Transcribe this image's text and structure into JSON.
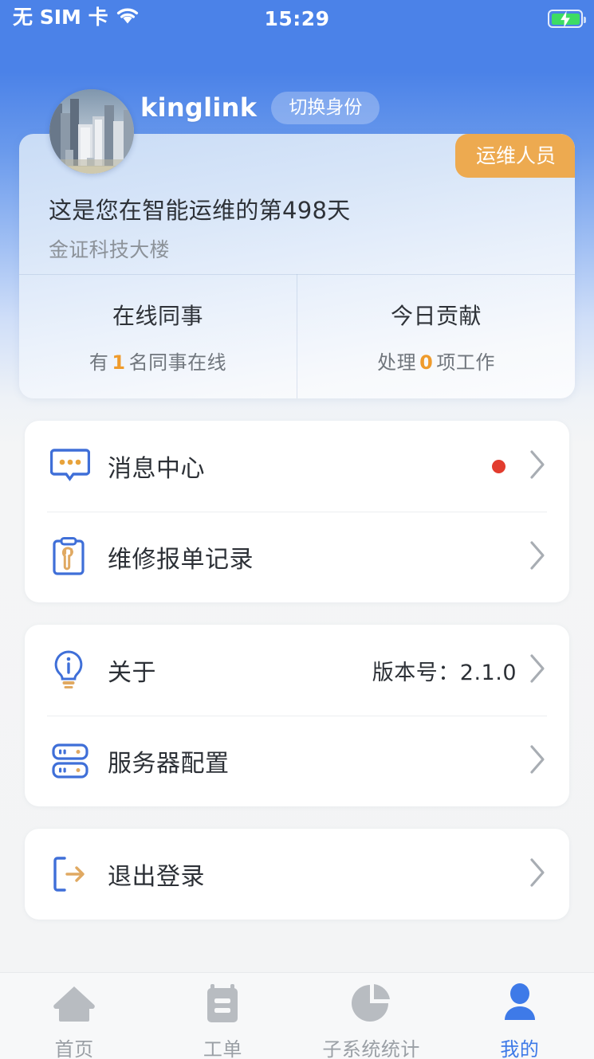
{
  "status_bar": {
    "carrier": "无 SIM 卡",
    "wifi_icon": "wifi-icon",
    "time": "15:29",
    "battery_icon": "battery-charging-icon"
  },
  "header": {
    "avatar_icon": "avatar-city-buildings",
    "username": "kinglink",
    "switch_identity_label": "切换身份"
  },
  "profile_card": {
    "role_badge": "运维人员",
    "days_text": "这是您在智能运维的第498天",
    "building": "金证科技大楼",
    "stats": [
      {
        "title": "在线同事",
        "prefix": "有",
        "number": "1",
        "suffix": "名同事在线"
      },
      {
        "title": "今日贡献",
        "prefix": "处理",
        "number": "0",
        "suffix": "项工作"
      }
    ]
  },
  "menu_groups": [
    {
      "rows": [
        {
          "icon": "message-bubble-icon",
          "label": "消息中心",
          "badge": "unread-dot",
          "chevron": "chevron-right-icon"
        },
        {
          "icon": "clipboard-wrench-icon",
          "label": "维修报单记录",
          "chevron": "chevron-right-icon"
        }
      ]
    },
    {
      "rows": [
        {
          "icon": "info-bulb-icon",
          "label": "关于",
          "value": "版本号：2.1.0",
          "chevron": "chevron-right-icon"
        },
        {
          "icon": "server-icon",
          "label": "服务器配置",
          "chevron": "chevron-right-icon"
        }
      ]
    },
    {
      "rows": [
        {
          "icon": "logout-icon",
          "label": "退出登录",
          "chevron": "chevron-right-icon"
        }
      ]
    }
  ],
  "tabbar": {
    "items": [
      {
        "icon": "home-icon",
        "label": "首页",
        "active": false
      },
      {
        "icon": "work-order-icon",
        "label": "工单",
        "active": false
      },
      {
        "icon": "pie-chart-icon",
        "label": "子系统统计",
        "active": false
      },
      {
        "icon": "person-icon",
        "label": "我的",
        "active": true
      }
    ]
  },
  "colors": {
    "brand_blue": "#4b82e8",
    "accent_orange": "#ef9b2c",
    "badge_orange": "#edaa50",
    "unread_red": "#e23c2e",
    "tab_active": "#3e7ae8",
    "tab_inactive": "#b8bcc1"
  }
}
